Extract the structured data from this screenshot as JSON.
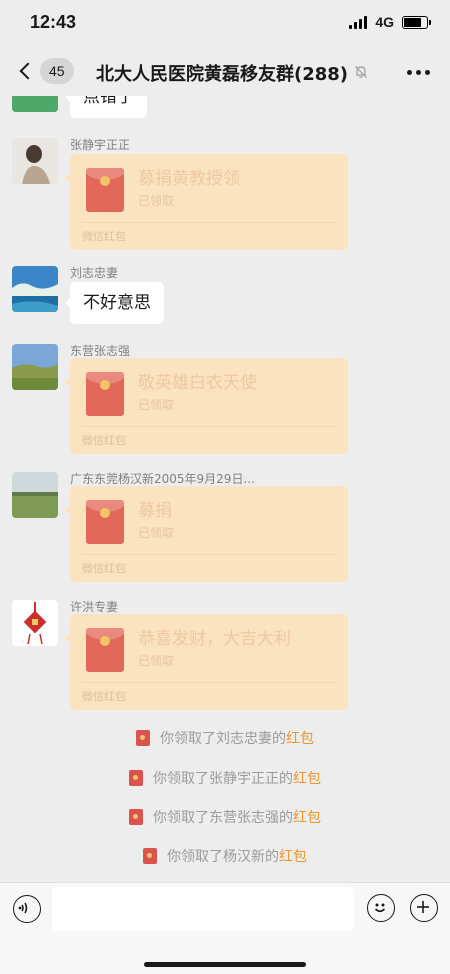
{
  "status_bar": {
    "time": "12:43",
    "network": "4G"
  },
  "nav": {
    "unread_count": "45",
    "title": "北大人民医院黄磊移友群(288)"
  },
  "messages": {
    "top_cut_text": "点错了",
    "m1": {
      "name": "张静宇正正",
      "wish": "募捐黄教授领",
      "status": "已领取",
      "footer": "微信红包"
    },
    "m2": {
      "name": "刘志忠妻",
      "text": "不好意思"
    },
    "m3": {
      "name": "东营张志强",
      "wish": "敬英雄白衣天使",
      "status": "已领取",
      "footer": "微信红包"
    },
    "m4": {
      "name": "广东东莞杨汉新2005年9月29日...",
      "wish": "募捐",
      "status": "已领取",
      "footer": "微信红包"
    },
    "m5": {
      "name": "许洪专妻",
      "wish": "恭喜发财，大吉大利",
      "status": "已领取",
      "footer": "微信红包"
    }
  },
  "notices": [
    {
      "prefix": "你领取了刘志忠妻的",
      "link": "红包"
    },
    {
      "prefix": "你领取了张静宇正正的",
      "link": "红包"
    },
    {
      "prefix": "你领取了东营张志强的",
      "link": "红包"
    },
    {
      "prefix": "你领取了杨汉新的",
      "link": "红包"
    }
  ],
  "icons": {
    "back": "chevron-left-icon",
    "mute": "bell-off-icon",
    "more": "more-icon",
    "voice": "voice-icon",
    "emoji": "emoji-icon",
    "plus": "plus-icon"
  },
  "colors": {
    "background": "#ededed",
    "red_packet_bg": "#fce3c0",
    "red_packet_icon": "#e2685a",
    "notice_link": "#e9962d"
  }
}
